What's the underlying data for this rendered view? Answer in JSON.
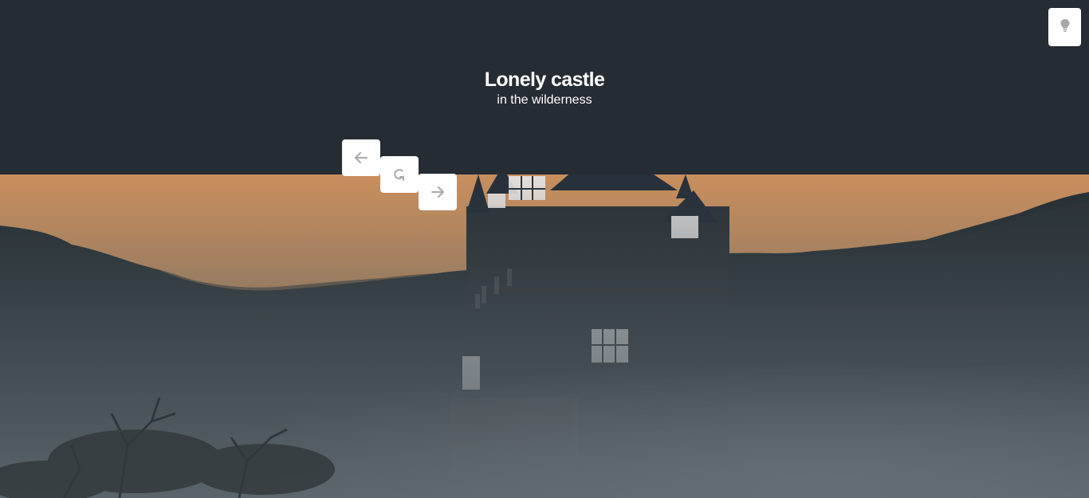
{
  "header": {
    "title": "Lonely castle",
    "subtitle": "in the wilderness"
  },
  "icons": {
    "hint": "lightbulb-icon",
    "prev": "arrow-left-icon",
    "reset": "rotate-icon",
    "next": "arrow-right-icon"
  },
  "colors": {
    "header_bg": "#262c34",
    "button_bg": "#ffffff",
    "icon_gray": "#a8a8a8",
    "sky_orange": "#d9a06c",
    "fog": "#5c666d"
  }
}
